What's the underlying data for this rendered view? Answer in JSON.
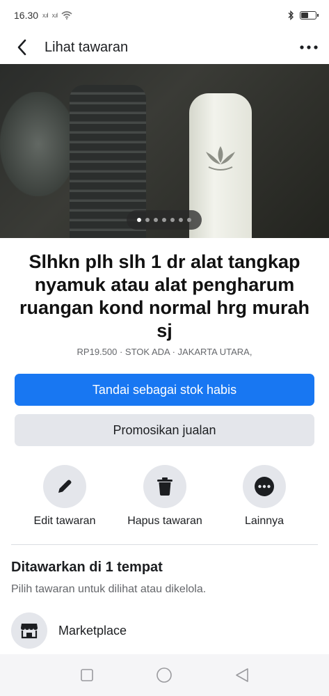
{
  "status": {
    "time": "16.30",
    "signal_1": "x.ıl",
    "signal_2": "x.ıl",
    "battery_level": 0.5
  },
  "header": {
    "title": "Lihat tawaran",
    "back_icon": "chevron-left-icon",
    "more_icon": "more-horizontal-icon"
  },
  "gallery": {
    "photo_count": 7,
    "current_index": 1
  },
  "listing": {
    "title": "Slhkn plh slh 1 dr alat tangkap nyamuk atau alat pengharum ruangan kond normal hrg murah sj",
    "meta": "RP19.500 · STOK ADA · JAKARTA UTARA,"
  },
  "buttons": {
    "mark_sold": "Tandai sebagai stok habis",
    "promote": "Promosikan jualan"
  },
  "actions": {
    "edit": {
      "label": "Edit tawaran",
      "icon": "pencil-icon"
    },
    "delete": {
      "label": "Hapus tawaran",
      "icon": "trash-icon"
    },
    "more": {
      "label": "Lainnya",
      "icon": "more-icon"
    }
  },
  "offered": {
    "title": "Ditawarkan di 1 tempat",
    "subtitle": "Pilih tawaran untuk dilihat atau dikelola.",
    "places": [
      {
        "label": "Marketplace",
        "icon": "marketplace-icon"
      }
    ]
  },
  "colors": {
    "primary": "#1877f2",
    "secondary_bg": "#e4e6eb",
    "muted_text": "#65676b"
  }
}
